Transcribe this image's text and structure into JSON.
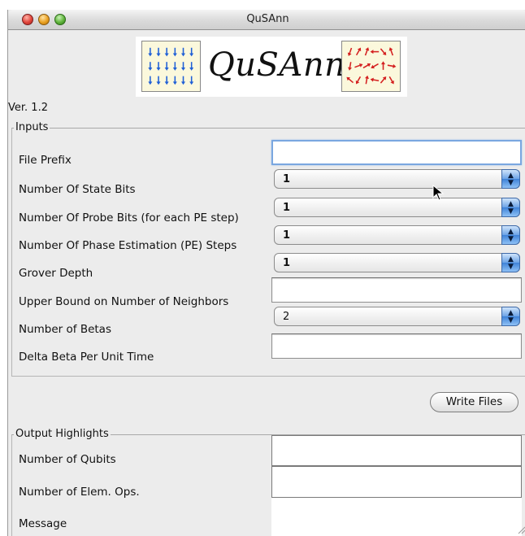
{
  "window": {
    "title": "QuSAnn"
  },
  "banner": {
    "logo_text": "QuSAnn"
  },
  "version": "Ver. 1.2",
  "inputs": {
    "group_title": "Inputs",
    "rows": [
      {
        "label": "File Prefix",
        "kind": "text",
        "value": ""
      },
      {
        "label": "Number Of State Bits",
        "kind": "select",
        "value": "1"
      },
      {
        "label": "Number Of Probe Bits (for each PE step)",
        "kind": "select",
        "value": "1"
      },
      {
        "label": "Number Of Phase Estimation (PE) Steps",
        "kind": "select",
        "value": "1"
      },
      {
        "label": "Grover Depth",
        "kind": "select",
        "value": "1"
      },
      {
        "label": "Upper Bound on Number of Neighbors",
        "kind": "text",
        "value": ""
      },
      {
        "label": "Number of Betas",
        "kind": "select",
        "value": "2"
      },
      {
        "label": "Delta Beta Per Unit Time",
        "kind": "text",
        "value": ""
      }
    ]
  },
  "write_button": "Write Files",
  "output": {
    "group_title": "Output Highlights",
    "rows": [
      {
        "label": "Number of Qubits",
        "value": ""
      },
      {
        "label": "Number of Elem. Ops.",
        "value": ""
      },
      {
        "label": "Message",
        "value": ""
      }
    ]
  },
  "colors": {
    "focus_ring": "#7aa7e0",
    "stepper_blue": "#3f82d8",
    "left_arrows": "#1f5fd6",
    "right_arrows": "#d42020"
  }
}
